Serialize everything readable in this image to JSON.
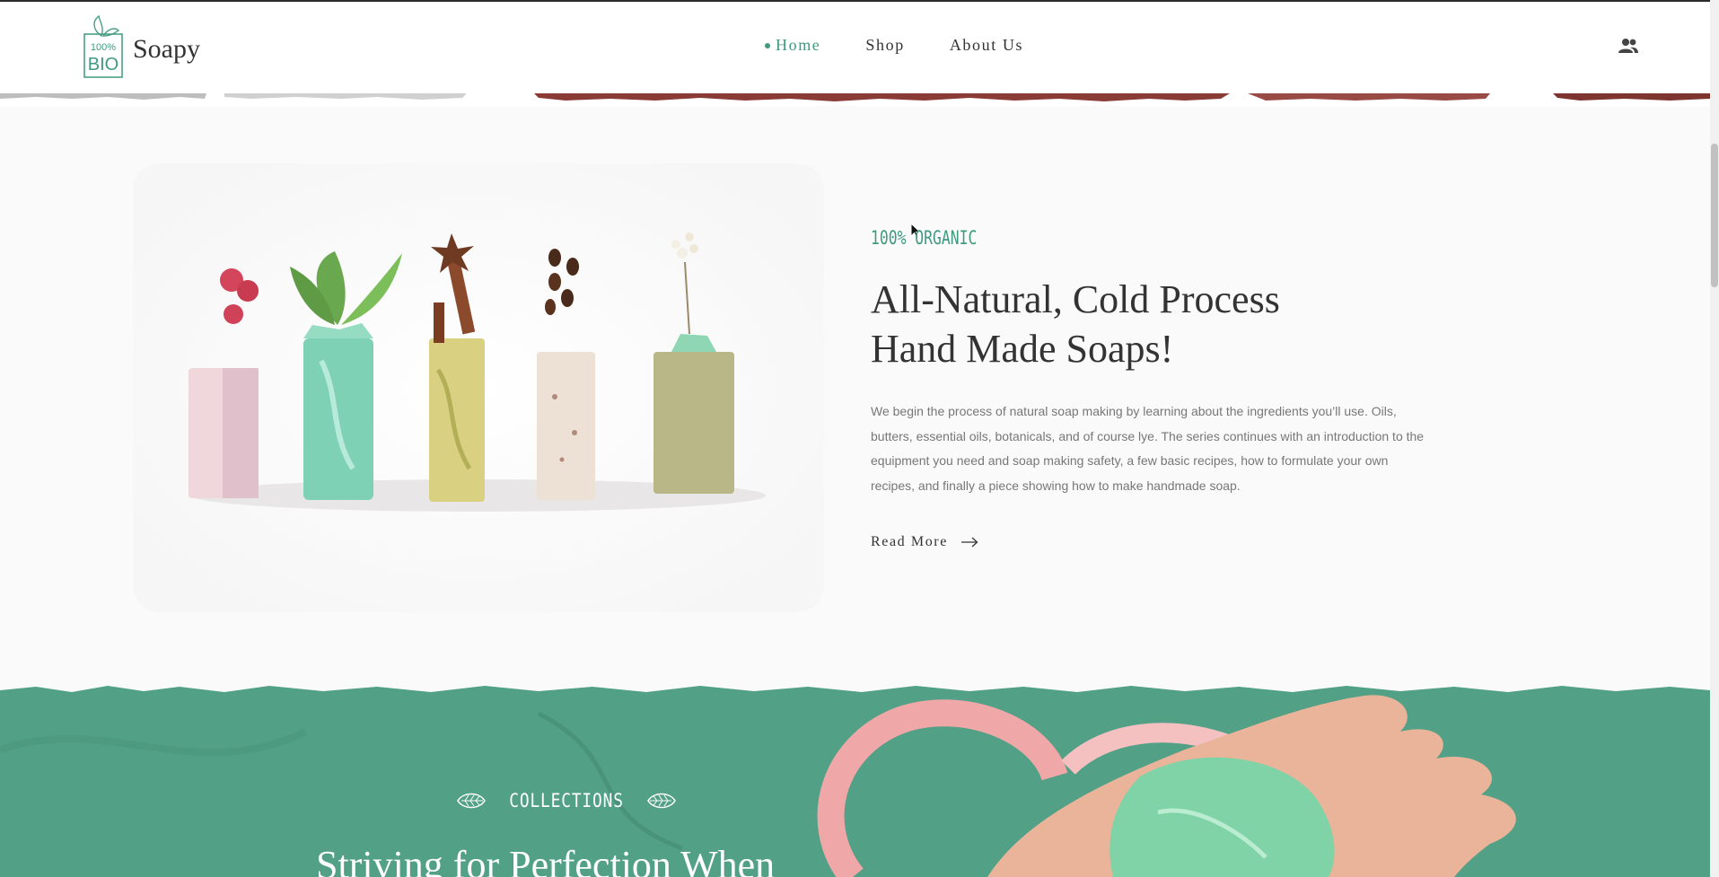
{
  "header": {
    "brand_badge_top": "100%",
    "brand_badge_bottom": "BIO",
    "brand_name": "Soapy",
    "nav": [
      {
        "label": "Home",
        "active": true
      },
      {
        "label": "Shop",
        "active": false
      },
      {
        "label": "About Us",
        "active": false
      }
    ],
    "user_icon": "users-icon"
  },
  "intro": {
    "eyebrow": "100% ORGANIC",
    "headline_line1": "All-Natural, Cold Process",
    "headline_line2": "Hand Made Soaps!",
    "body": "We begin the process of natural soap making by learning about the ingredients you’ll use. Oils, butters, essential oils, botanicals, and of course lye. The series continues with an introduction to the equipment you need and soap making safety, a few basic recipes, how to formulate your own recipes, and finally a piece showing how to make handmade soap.",
    "read_more": "Read More"
  },
  "collections": {
    "label": "COLLECTIONS",
    "title": "Striving for Perfection When"
  },
  "colors": {
    "accent": "#3f9a7e",
    "teal_bg": "#52a086",
    "pink": "#f0a7a8",
    "soap_green": "#7fd3a6"
  }
}
